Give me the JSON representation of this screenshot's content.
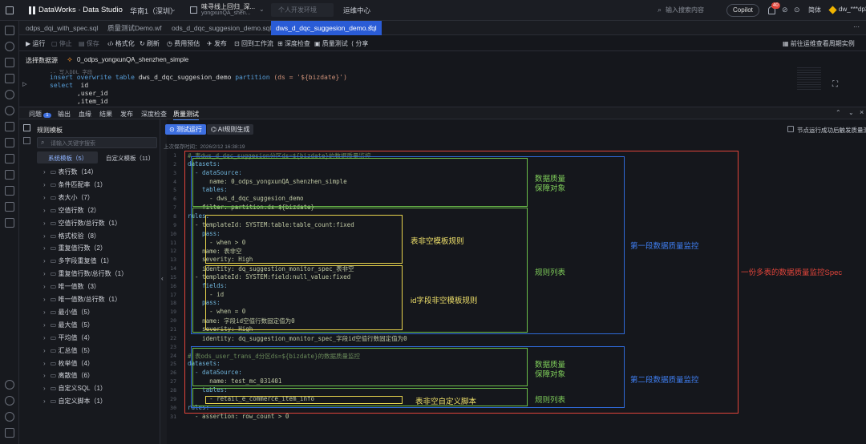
{
  "colors": {
    "accent": "#2a5cd6",
    "red_box": "#e0443a",
    "blue_box": "#2f6ad8",
    "green_box": "#6cbf4a",
    "yellow_box": "#e8d44d"
  },
  "topbar": {
    "logo_text": "DataWorks · Data Studio",
    "region": "华南1（深圳）",
    "workspace_line1": "味寻线上回归_深...",
    "workspace_line2": "yongxunQA_shen...",
    "env": "个人开发环境",
    "ops_center": "运维中心",
    "search_placeholder": "输入搜索内容",
    "copilot": "Copilot",
    "notify_count": "40",
    "lang": "简体",
    "user": "dw_***dp3"
  },
  "tabs": [
    {
      "label": "odps_dqi_with_spec.sql"
    },
    {
      "label": "质量测试Demo.wf"
    },
    {
      "label": "ods_d_dqc_suggesion_demo.sql"
    },
    {
      "label": "dws_d_dqc_suggesion_demo.sql"
    }
  ],
  "toolbar": {
    "run": "运行",
    "stop": "停止",
    "prettify": "格式化",
    "refresh": "刷新",
    "cost": "费用预估",
    "publish": "发布",
    "back": "回到工作流",
    "deep_check": "深度检查",
    "quality": "质量测试",
    "share": "分享",
    "cycle": "前往运维查看周期实例"
  },
  "datasource": {
    "label": "选择数据源",
    "value": "0_odps_yongxunQA_shenzhen_simple"
  },
  "editor": {
    "comment": "-- 写入DDL 字段",
    "line1_kw": "insert overwrite table",
    "line1_table": "dws_d_dqc_suggesion_demo",
    "line1_kw2": "partition",
    "line1_rest": "(ds = '${bizdate}')",
    "line2_kw": "select",
    "line2_rest": "id",
    "line3": ",user_id",
    "line4": ",item_id"
  },
  "panel_tabs": [
    {
      "label": "问题",
      "badge": "1"
    },
    {
      "label": "输出"
    },
    {
      "label": "血缘"
    },
    {
      "label": "结果"
    },
    {
      "label": "发布"
    },
    {
      "label": "深度检查"
    },
    {
      "label": "质量测试"
    }
  ],
  "rules_panel": {
    "title": "规则模板",
    "search_placeholder": "请输入关键字搜索",
    "tab_system": "系统模板（5）",
    "tab_custom": "自定义模板（11）",
    "items": [
      "表行数（14）",
      "条件匹配率（1）",
      "表大小（7）",
      "空值行数（2）",
      "空值行数/总行数（1）",
      "格式校验（8）",
      "重复值行数（2）",
      "多字段重复值（1）",
      "重复值行数/总行数（1）",
      "唯一值数（3）",
      "唯一值数/总行数（1）",
      "最小值（5）",
      "最大值（5）",
      "平均值（4）",
      "汇总值（5）",
      "枚举值（4）",
      "离散值（6）",
      "自定义SQL（1）",
      "自定义脚本（1）"
    ]
  },
  "quality": {
    "run_test": "测试运行",
    "ai_gen": "AI规则生成",
    "trigger_label": "节点运行成功后触发质量测试",
    "saved_time": "上次保存时间：2026/2/12 16:38:19",
    "yaml": [
      {
        "n": "1",
        "t": "# 表dws_d_dqc_suggesion分区ds=${bizdate}的数据质量监控",
        "c": "c"
      },
      {
        "n": "2",
        "t": "datasets:",
        "c": "k"
      },
      {
        "n": "3",
        "t": "  - dataSource:",
        "c": "k"
      },
      {
        "n": "4",
        "t": "      name: 0_odps_yongxunQA_shenzhen_simple",
        "c": "v"
      },
      {
        "n": "5",
        "t": "    tables:",
        "c": "k"
      },
      {
        "n": "6",
        "t": "      - dws_d_dqc_suggesion_demo",
        "c": "v"
      },
      {
        "n": "7",
        "t": "    filter: partition:ds=${bizdate}",
        "c": "v"
      },
      {
        "n": "8",
        "t": "rules:",
        "c": "k"
      },
      {
        "n": "9",
        "t": "  - templateId: SYSTEM:table:table_count:fixed",
        "c": "v"
      },
      {
        "n": "10",
        "t": "    pass:",
        "c": "k"
      },
      {
        "n": "11",
        "t": "      - when > 0",
        "c": "v"
      },
      {
        "n": "12",
        "t": "    name: 表非空",
        "c": "v"
      },
      {
        "n": "13",
        "t": "    severity: High",
        "c": "v"
      },
      {
        "n": "14",
        "t": "    identity: dq_suggestion_monitor_spec_表非空",
        "c": "v"
      },
      {
        "n": "15",
        "t": "  - templateId: SYSTEM:field:null_value:fixed",
        "c": "v"
      },
      {
        "n": "16",
        "t": "    fields:",
        "c": "k"
      },
      {
        "n": "17",
        "t": "      - id",
        "c": "v"
      },
      {
        "n": "18",
        "t": "    pass:",
        "c": "k"
      },
      {
        "n": "19",
        "t": "      - when = 0",
        "c": "v"
      },
      {
        "n": "20",
        "t": "    name: 字段id空值行数固定值为0",
        "c": "v"
      },
      {
        "n": "21",
        "t": "    severity: High",
        "c": "v"
      },
      {
        "n": "22",
        "t": "    identity: dq_suggestion_monitor_spec_字段id空值行数固定值为0",
        "c": "v"
      },
      {
        "n": "23",
        "t": "",
        "c": "d"
      },
      {
        "n": "24",
        "t": "# 表ods_user_trans_d分区ds=${bizdate}的数据质量监控",
        "c": "c"
      },
      {
        "n": "25",
        "t": "datasets:",
        "c": "k"
      },
      {
        "n": "26",
        "t": "  - dataSource:",
        "c": "k"
      },
      {
        "n": "27",
        "t": "      name: test_mc_031401",
        "c": "v"
      },
      {
        "n": "28",
        "t": "    tables:",
        "c": "k"
      },
      {
        "n": "29",
        "t": "      - retail_e_commerce_item_info",
        "c": "v"
      },
      {
        "n": "30",
        "t": "rules:",
        "c": "k"
      },
      {
        "n": "31",
        "t": "  - assertion: row_count > 0",
        "c": "v"
      }
    ],
    "annotations": {
      "dq_target_1a": "数据质量",
      "dq_target_1b": "保障对象",
      "rule_list_1": "规则列表",
      "table_nonempty": "表非空模板规则",
      "id_nonnull": "id字段非空模板规则",
      "section1": "第一段数据质量监控",
      "whole": "一份多表的数据质量监控Spec",
      "dq_target_2a": "数据质量",
      "dq_target_2b": "保障对象",
      "rule_list_2": "规则列表",
      "section2": "第二段数据质量监控",
      "custom_script": "表非空自定义脚本"
    }
  }
}
